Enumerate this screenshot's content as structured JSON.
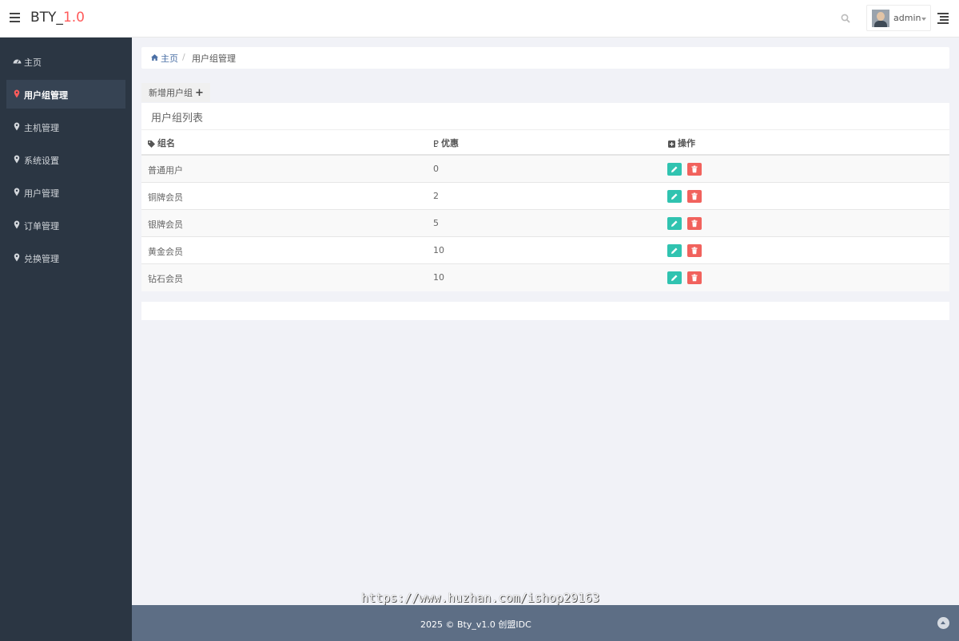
{
  "header": {
    "brand_main": "BTY_",
    "brand_version": "1.0",
    "user_name": "admin"
  },
  "sidebar": {
    "items": [
      {
        "label": "主页",
        "icon": "dashboard-icon"
      },
      {
        "label": "用户组管理",
        "icon": "map-marker-icon",
        "active": true
      },
      {
        "label": "主机管理",
        "icon": "map-marker-icon"
      },
      {
        "label": "系统设置",
        "icon": "map-marker-icon"
      },
      {
        "label": "用户管理",
        "icon": "map-marker-icon"
      },
      {
        "label": "订单管理",
        "icon": "map-marker-icon"
      },
      {
        "label": "兑换管理",
        "icon": "map-marker-icon"
      }
    ]
  },
  "breadcrumb": {
    "home": "主页",
    "separator": "/",
    "current": "用户组管理"
  },
  "toolbar": {
    "add_label": "新增用户组",
    "add_icon": "+"
  },
  "panel": {
    "title": "用户组列表"
  },
  "table": {
    "headers": [
      {
        "label": "组名",
        "icon": "tag-icon"
      },
      {
        "label": "优惠",
        "icon": "bitcoin-icon"
      },
      {
        "label": "操作",
        "icon": "plus-square-icon"
      }
    ],
    "rows": [
      {
        "name": "普通用户",
        "discount": "0"
      },
      {
        "name": "铜牌会员",
        "discount": "2"
      },
      {
        "name": "银牌会员",
        "discount": "5"
      },
      {
        "name": "黄金会员",
        "discount": "10"
      },
      {
        "name": "钻石会员",
        "discount": "10"
      }
    ]
  },
  "watermark": "https://www.huzhan.com/ishop29163",
  "footer": {
    "text": "2025 © Bty_v1.0 创盟IDC"
  },
  "colors": {
    "sidebar_bg": "#2b3643",
    "accent_red": "#ff5b5b",
    "edit_button": "#30c3b0",
    "delete_button": "#f1625d",
    "footer_bg": "#5d6e85"
  }
}
